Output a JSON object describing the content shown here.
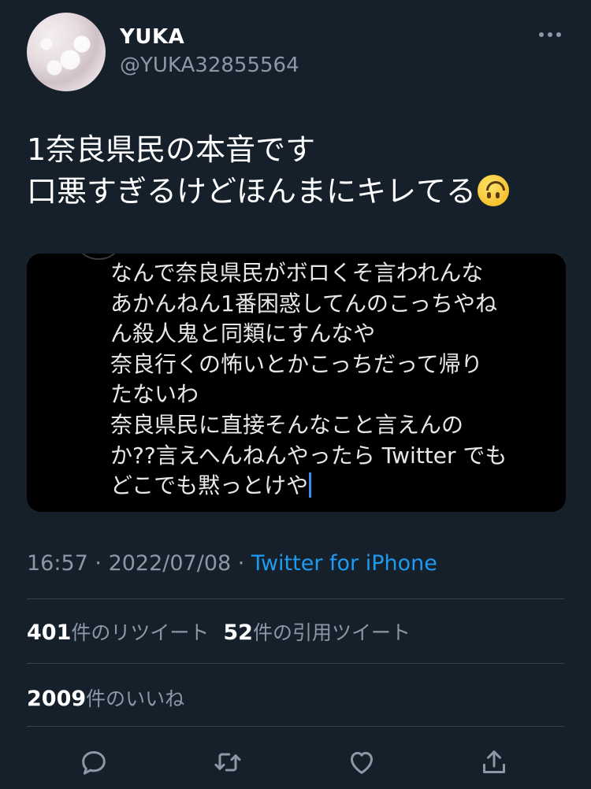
{
  "user": {
    "name": "YUKA",
    "handle": "@YUKA32855564"
  },
  "tweet": {
    "lines": [
      "1奈良県民の本音です",
      "口悪すぎるけどほんまにキレてる"
    ],
    "emoji_icon": "upside-down-face-emoji"
  },
  "media": {
    "lines": [
      "なんで奈良県民がボロくそ言われんな",
      "あかんねん1番困惑してんのこっちやね",
      "ん殺人鬼と同類にすんなや",
      "奈良行くの怖いとかこっちだって帰り",
      "たないわ",
      "奈良県民に直接そんなこと言えんの",
      "か??言えへんねんやったら Twitter でも",
      "どこでも黙っとけや"
    ]
  },
  "meta": {
    "time": "16:57",
    "sep1": " · ",
    "date": "2022/07/08",
    "sep2": " · ",
    "source": "Twitter for iPhone"
  },
  "stats": {
    "retweets_count": "401",
    "retweets_label": "件のリツイート",
    "quotes_count": "52",
    "quotes_label": "件の引用ツイート",
    "likes_count": "2009",
    "likes_label": "件のいいね"
  },
  "actions": {
    "icons": [
      "reply-icon",
      "retweet-icon",
      "like-icon",
      "share-icon"
    ]
  },
  "colors": {
    "background": "#15202b",
    "secondary_text": "#8b98a5",
    "link": "#1d9bf0",
    "divider": "#38444d"
  }
}
